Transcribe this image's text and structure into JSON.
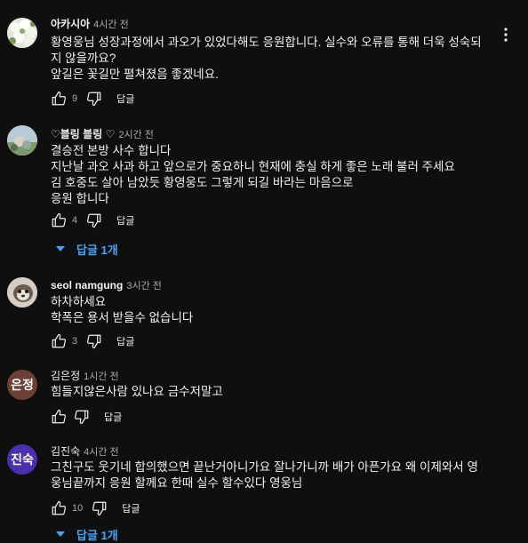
{
  "comments": [
    {
      "author": "아카시아",
      "time": "4시간 전",
      "lines": [
        "황영웅님 성장과정에서 과오가 있었다해도 응원합니다. 실수와 오류를 통해 더욱 성숙되",
        "지 않을까요?",
        "앞길은 꽃길만 펼쳐졌음 좋겠네요."
      ],
      "likes": "9",
      "reply_label": "답글"
    },
    {
      "author": "♡블링 블링 ♡",
      "time": "2시간 전",
      "lines": [
        "결승전 본방  사수  합니다",
        "지난날  과오 사과 하고  앞으로가  중요하니  현재에  충실  하게  좋은 노래  불러 주세요",
        "김 호중도  살아 남았듯  황영웅도   그렇게 되길   바라는  마음으로",
        "응원  합니다"
      ],
      "likes": "4",
      "reply_label": "답글",
      "replies_toggle": "답글 1개"
    },
    {
      "author": "seol namgung",
      "time": "3시간 전",
      "lines": [
        "하차하세요",
        "학폭은 용서 받을수 없습니다"
      ],
      "likes": "3",
      "reply_label": "답글"
    },
    {
      "author": "김은정",
      "time": "1시간 전",
      "avatar_text": "은정",
      "lines": [
        "힘들지않은사람 있나요 금수저말고"
      ],
      "likes": "",
      "reply_label": "답글"
    },
    {
      "author": "김진숙",
      "time": "4시간 전",
      "avatar_text": "진숙",
      "lines": [
        "그친구도 웃기네 합의했으면 끝난거아니가요  잘나가니까 배가 아픈가요 왜 이제와서 영",
        "웅님끝까지 응원 할께요 한때 실수 할수있다 영웅님"
      ],
      "likes": "10",
      "reply_label": "답글",
      "replies_toggle": "답글 1개"
    }
  ],
  "colors": {
    "background": "#0f0f0f",
    "link": "#3ea6ff",
    "avatar_eunjeong": "#6d3f35",
    "avatar_jinsuk": "#4a2fb0"
  },
  "icons": [
    "thumb-up-icon",
    "thumb-down-icon",
    "more-vert-icon",
    "caret-down-icon"
  ]
}
